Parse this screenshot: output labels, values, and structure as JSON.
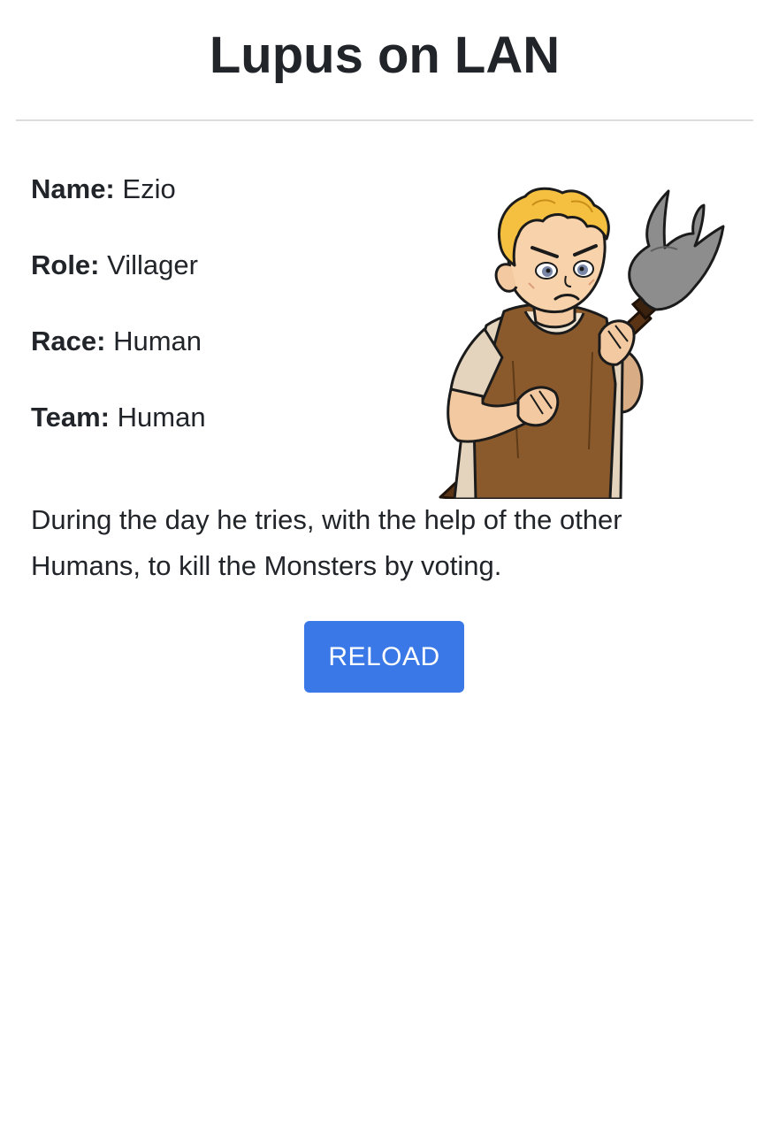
{
  "header": {
    "title": "Lupus on LAN"
  },
  "character": {
    "fields": [
      {
        "label": "Name:",
        "value": "Ezio"
      },
      {
        "label": "Role:",
        "value": "Villager"
      },
      {
        "label": "Race:",
        "value": "Human"
      },
      {
        "label": "Team:",
        "value": "Human"
      }
    ],
    "image_icon": "villager-with-pitchfork",
    "description": "During the day he tries, with the help of the other Humans, to kill the Monsters by voting."
  },
  "actions": {
    "reload_label": "RELOAD",
    "button_color": "#3b78e7"
  }
}
